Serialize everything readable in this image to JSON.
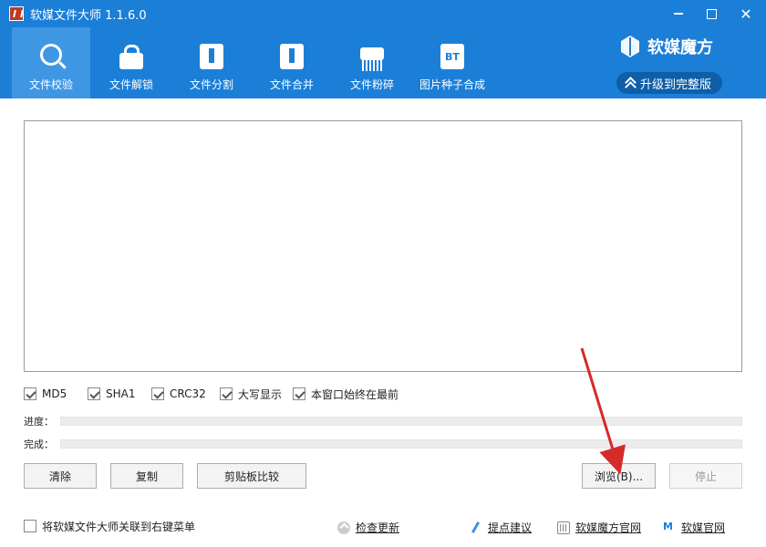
{
  "window": {
    "title": "软媒文件大师 1.1.6.0"
  },
  "nav": {
    "tabs": [
      {
        "label": "文件校验",
        "icon": "magnifier-icon",
        "active": true
      },
      {
        "label": "文件解锁",
        "icon": "unlock-icon",
        "active": false
      },
      {
        "label": "文件分割",
        "icon": "file-split-icon",
        "active": false
      },
      {
        "label": "文件合并",
        "icon": "file-merge-icon",
        "active": false
      },
      {
        "label": "文件粉碎",
        "icon": "shredder-icon",
        "active": false
      },
      {
        "label": "图片种子合成",
        "icon": "bt-icon",
        "icon_text": "BT",
        "active": false
      }
    ]
  },
  "brand": {
    "name": "软媒魔方",
    "upgrade_label": "升级到完整版"
  },
  "options": [
    {
      "label": "MD5",
      "checked": true
    },
    {
      "label": "SHA1",
      "checked": true
    },
    {
      "label": "CRC32",
      "checked": true
    },
    {
      "label": "大写显示",
      "checked": true
    },
    {
      "label": "本窗口始终在最前",
      "checked": true
    }
  ],
  "progress": {
    "current_label": "进度：",
    "current_value": 0,
    "total_label": "完成：",
    "total_value": 0
  },
  "buttons": {
    "clear": "清除",
    "copy": "复制",
    "clipboard_compare": "剪贴板比较",
    "browse": "浏览(B)...",
    "stop": "停止"
  },
  "footer": {
    "context_menu_label": "将软媒文件大师关联到右键菜单",
    "context_menu_checked": false,
    "check_update": "检查更新",
    "suggest": "提点建议",
    "mofang_site": "软媒魔方官网",
    "official_site": "软媒官网"
  },
  "colors": {
    "header": "#1b7fd8",
    "active_tab": "#3f97e3",
    "annotation_arrow": "#d62a2a"
  }
}
